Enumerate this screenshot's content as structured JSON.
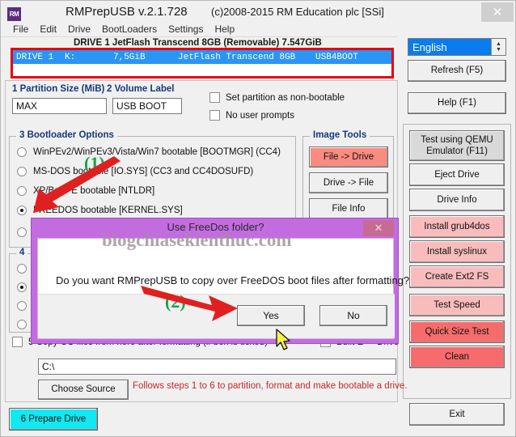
{
  "window": {
    "logo": "RM",
    "title": "RMPrepUSB v.2.1.728",
    "copyright": "(c)2008-2015 RM Education plc [SSi]",
    "close_icon": "✕"
  },
  "menu": {
    "items": [
      "File",
      "Edit",
      "Drive",
      "BootLoaders",
      "Settings",
      "Help"
    ]
  },
  "drive": {
    "header": "DRIVE 1 JetFlash Transcend 8GB  (Removable) 7.547GiB",
    "row": {
      "number": "DRIVE 1",
      "letter": "K:",
      "size": "7,5GiB",
      "model": "JetFlash Transcend 8GB",
      "label": "USB4BOOT"
    }
  },
  "fields": {
    "partition_size_label": "1 Partition Size (MiB)",
    "partition_size_value": "MAX",
    "volume_label_label": "2 Volume Label",
    "volume_label_value": "USB BOOT"
  },
  "checkboxes": {
    "non_bootable": "Set partition as non-bootable",
    "no_user_prompts": "No user prompts",
    "copy_os_files": "5 Copy OS files from here after formatting (if box is ticked)",
    "built_e_drive": "Built E -> Drive"
  },
  "bootloader": {
    "title": "3 Bootloader Options",
    "options": [
      {
        "label": "WinPEv2/WinPEv3/Vista/Win7 bootable [BOOTMGR] (CC4)",
        "selected": false
      },
      {
        "label": "MS-DOS bootable [IO.SYS]    (CC3 and CC4DOSUFD)",
        "selected": false
      },
      {
        "label": "XP/BartPE bootable [NTLDR]",
        "selected": false
      },
      {
        "label": "FREEDOS bootable [KERNEL.SYS]",
        "selected": true
      },
      {
        "label": "",
        "selected": false
      }
    ]
  },
  "filesystem": {
    "title": "4",
    "options": [
      {
        "label": "",
        "selected": false
      },
      {
        "label": "",
        "selected": true
      },
      {
        "label": "",
        "selected": false
      },
      {
        "label": "",
        "selected": false
      }
    ]
  },
  "image_tools": {
    "title": "Image Tools",
    "buttons": [
      {
        "label": "File -> Drive",
        "accent": "#fa8b80"
      },
      {
        "label": "Drive -> File",
        "accent": "#efefef"
      },
      {
        "label": "File Info",
        "accent": "#efefef"
      }
    ]
  },
  "right_panel": {
    "language": "English",
    "refresh": "Refresh (F5)",
    "help": "Help (F1)",
    "qemu": "Test using QEMU\nEmulator (F11)",
    "eject": "Eject Drive",
    "drive_info": "Drive Info",
    "install_grub4dos": "Install grub4dos",
    "install_syslinux": "Install syslinux",
    "create_ext2": "Create Ext2 FS",
    "test_speed": "Test Speed",
    "quick_size_test": "Quick Size Test",
    "clean": "Clean",
    "exit": "Exit"
  },
  "bottom": {
    "source_path": "C:\\",
    "choose_source": "Choose Source",
    "hint": "Follows steps 1 to 6 to partition, format and make bootable a drive.",
    "prepare_drive": "6 Prepare Drive"
  },
  "dialog": {
    "title": "Use FreeDos folder?",
    "close_icon": "✕",
    "message": "Do you want RMPrepUSB to copy over FreeDOS boot files after formatting?",
    "yes": "Yes",
    "no": "No"
  },
  "watermark": "blogchiasekienthuc.com",
  "annotations": {
    "step1": "(1)",
    "step2": "(2)",
    "arrow_color": "#e02020"
  },
  "colors": {
    "accent_blue": "#2a95f5",
    "label_blue": "#16387c",
    "hint_red": "#c22a2a",
    "highlight_red": "#e8000d",
    "dialog_purple": "#c36ce0",
    "prepare_cyan": "#12e8f2",
    "annotation_green": "#17a24a"
  }
}
